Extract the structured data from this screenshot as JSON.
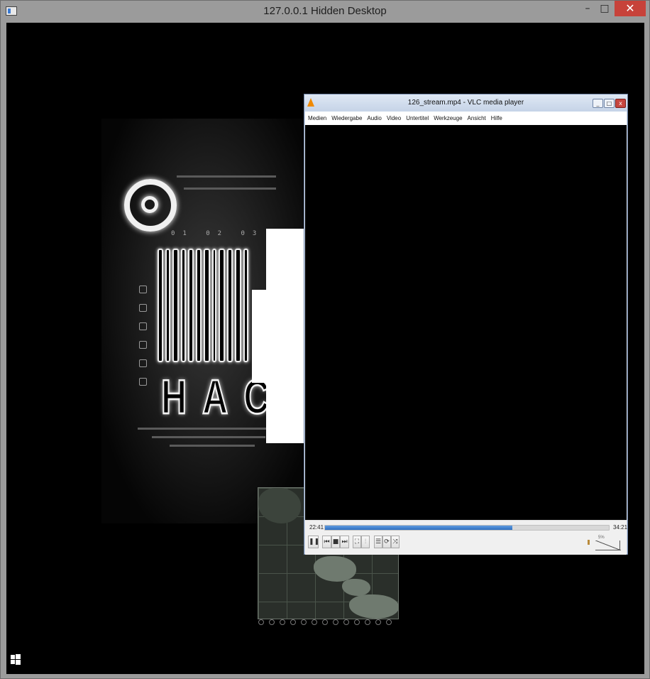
{
  "outer_window": {
    "title": "127.0.0.1 Hidden Desktop",
    "min_glyph": "–",
    "max_glyph": "□",
    "close_glyph": "✕"
  },
  "wallpaper": {
    "barcode_numbers": "01 02 03 04 05 06 07",
    "hack_text": "HACK"
  },
  "vlc": {
    "title": "126_stream.mp4 - VLC media player",
    "menu": [
      "Medien",
      "Wiedergabe",
      "Audio",
      "Video",
      "Untertitel",
      "Werkzeuge",
      "Ansicht",
      "Hilfe"
    ],
    "time_elapsed": "22:41",
    "time_total": "34:21",
    "progress_fraction": 0.66,
    "volume_label": "5%",
    "buttons": {
      "pause": "❚❚",
      "previous": "⏮",
      "stop": "■",
      "next": "⏭",
      "fullscreen": "⛶",
      "extended": "⫶",
      "playlist": "☰",
      "loop": "⟳",
      "random": "⤨"
    }
  },
  "colors": {
    "vlc_progress": "#2f6fc0",
    "close_red": "#c7423a",
    "vlc_cone": "#f08a00"
  }
}
